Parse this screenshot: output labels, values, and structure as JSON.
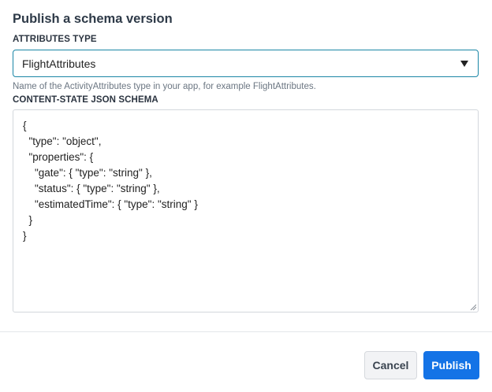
{
  "dialog": {
    "title": "Publish a schema version",
    "attributes_label": "ATTRIBUTES TYPE",
    "attributes_value": "FlightAttributes",
    "attributes_help": "Name of the ActivityAttributes type in your app, for example FlightAttributes.",
    "schema_label": "CONTENT-STATE JSON SCHEMA",
    "schema_lines": [
      "{",
      "  \"type\": \"object\",",
      "  \"properties\": {",
      "    \"gate\": { \"type\": \"string\" },",
      "    \"status\": { \"type\": \"string\" },",
      "    \"estimatedTime\": { \"type\": \"string\" }",
      "  }",
      "}"
    ],
    "cancel_label": "Cancel",
    "publish_label": "Publish"
  },
  "colors": {
    "accent": "#1473e6",
    "focus_border": "#1a86a6"
  },
  "icons": {
    "select": "chevron-down-icon",
    "resize": "resize-grip-icon"
  }
}
